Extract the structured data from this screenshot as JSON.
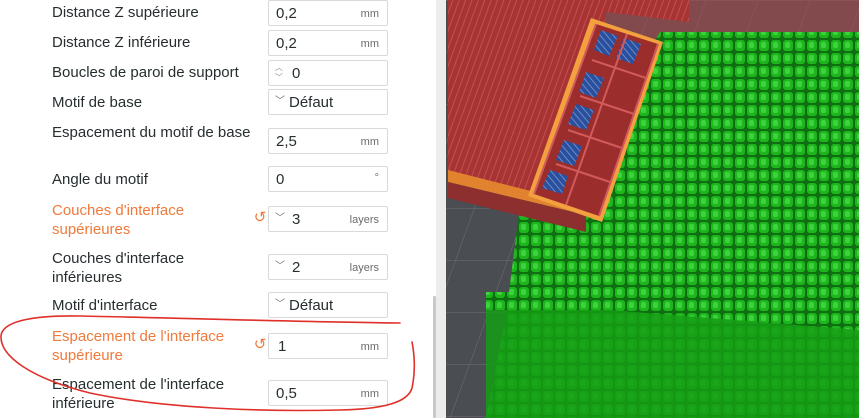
{
  "settings": [
    {
      "label": "Distance Z supérieure",
      "value": "0,2",
      "unit": "mm",
      "control": "text",
      "modified": false
    },
    {
      "label": "Distance Z inférieure",
      "value": "0,2",
      "unit": "mm",
      "control": "text",
      "modified": false
    },
    {
      "label": "Boucles de paroi de support",
      "value": "0",
      "unit": "",
      "control": "spin",
      "modified": false
    },
    {
      "label": "Motif de base",
      "value": "Défaut",
      "unit": "",
      "control": "dropdown",
      "modified": false
    },
    {
      "label": "Espacement du motif de base",
      "value": "2,5",
      "unit": "mm",
      "control": "text",
      "modified": false
    },
    {
      "label": "Angle du motif",
      "value": "0",
      "unit": "°",
      "control": "text",
      "modified": false
    },
    {
      "label": "Couches d'interface supérieures",
      "value": "3",
      "unit": "layers",
      "control": "spin-dropdown",
      "modified": true
    },
    {
      "label": "Couches d'interface inférieures",
      "value": "2",
      "unit": "layers",
      "control": "spin-dropdown",
      "modified": false
    },
    {
      "label": "Motif d'interface",
      "value": "Défaut",
      "unit": "",
      "control": "dropdown",
      "modified": false
    },
    {
      "label": "Espacement de l'interface supérieure",
      "value": "1",
      "unit": "mm",
      "control": "text",
      "modified": true
    },
    {
      "label": "Espacement de l'interface inférieure",
      "value": "0,5",
      "unit": "mm",
      "control": "text",
      "modified": false
    }
  ],
  "icons": {
    "reset": "↺",
    "chevron": "﹀",
    "spin_up": "︿",
    "spin_down": "﹀"
  },
  "colors": {
    "modified_label": "#ef7a3b",
    "annotation": "#e0302a",
    "support_green": "#1aa51a",
    "model_red": "#b23a3a",
    "grid_bg": "#4a4d52"
  }
}
